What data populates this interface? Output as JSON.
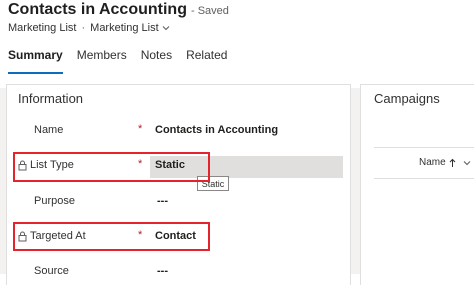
{
  "record": {
    "title": "Contacts in Accounting",
    "save_status": "- Saved",
    "entity": "Marketing List",
    "separator": "·",
    "form_selector": "Marketing List"
  },
  "tabs": [
    {
      "label": "Summary",
      "selected": true
    },
    {
      "label": "Members",
      "selected": false
    },
    {
      "label": "Notes",
      "selected": false
    },
    {
      "label": "Related",
      "selected": false
    }
  ],
  "information": {
    "title": "Information",
    "fields": [
      {
        "label": "Name",
        "required": "*",
        "value": "Contacts in Accounting",
        "locked": false
      },
      {
        "label": "List Type",
        "required": "*",
        "value": "Static",
        "locked": true
      },
      {
        "label": "Purpose",
        "required": "",
        "value": "---",
        "locked": false
      },
      {
        "label": "Targeted At",
        "required": "*",
        "value": "Contact",
        "locked": true
      },
      {
        "label": "Source",
        "required": "",
        "value": "---",
        "locked": false
      }
    ],
    "tooltip": "Static"
  },
  "campaigns": {
    "title": "Campaigns",
    "column_header": "Name",
    "sort": "ascending"
  },
  "colors": {
    "accent": "#0f6cbd",
    "required": "#a4262c",
    "annotation": "#e3242b"
  }
}
